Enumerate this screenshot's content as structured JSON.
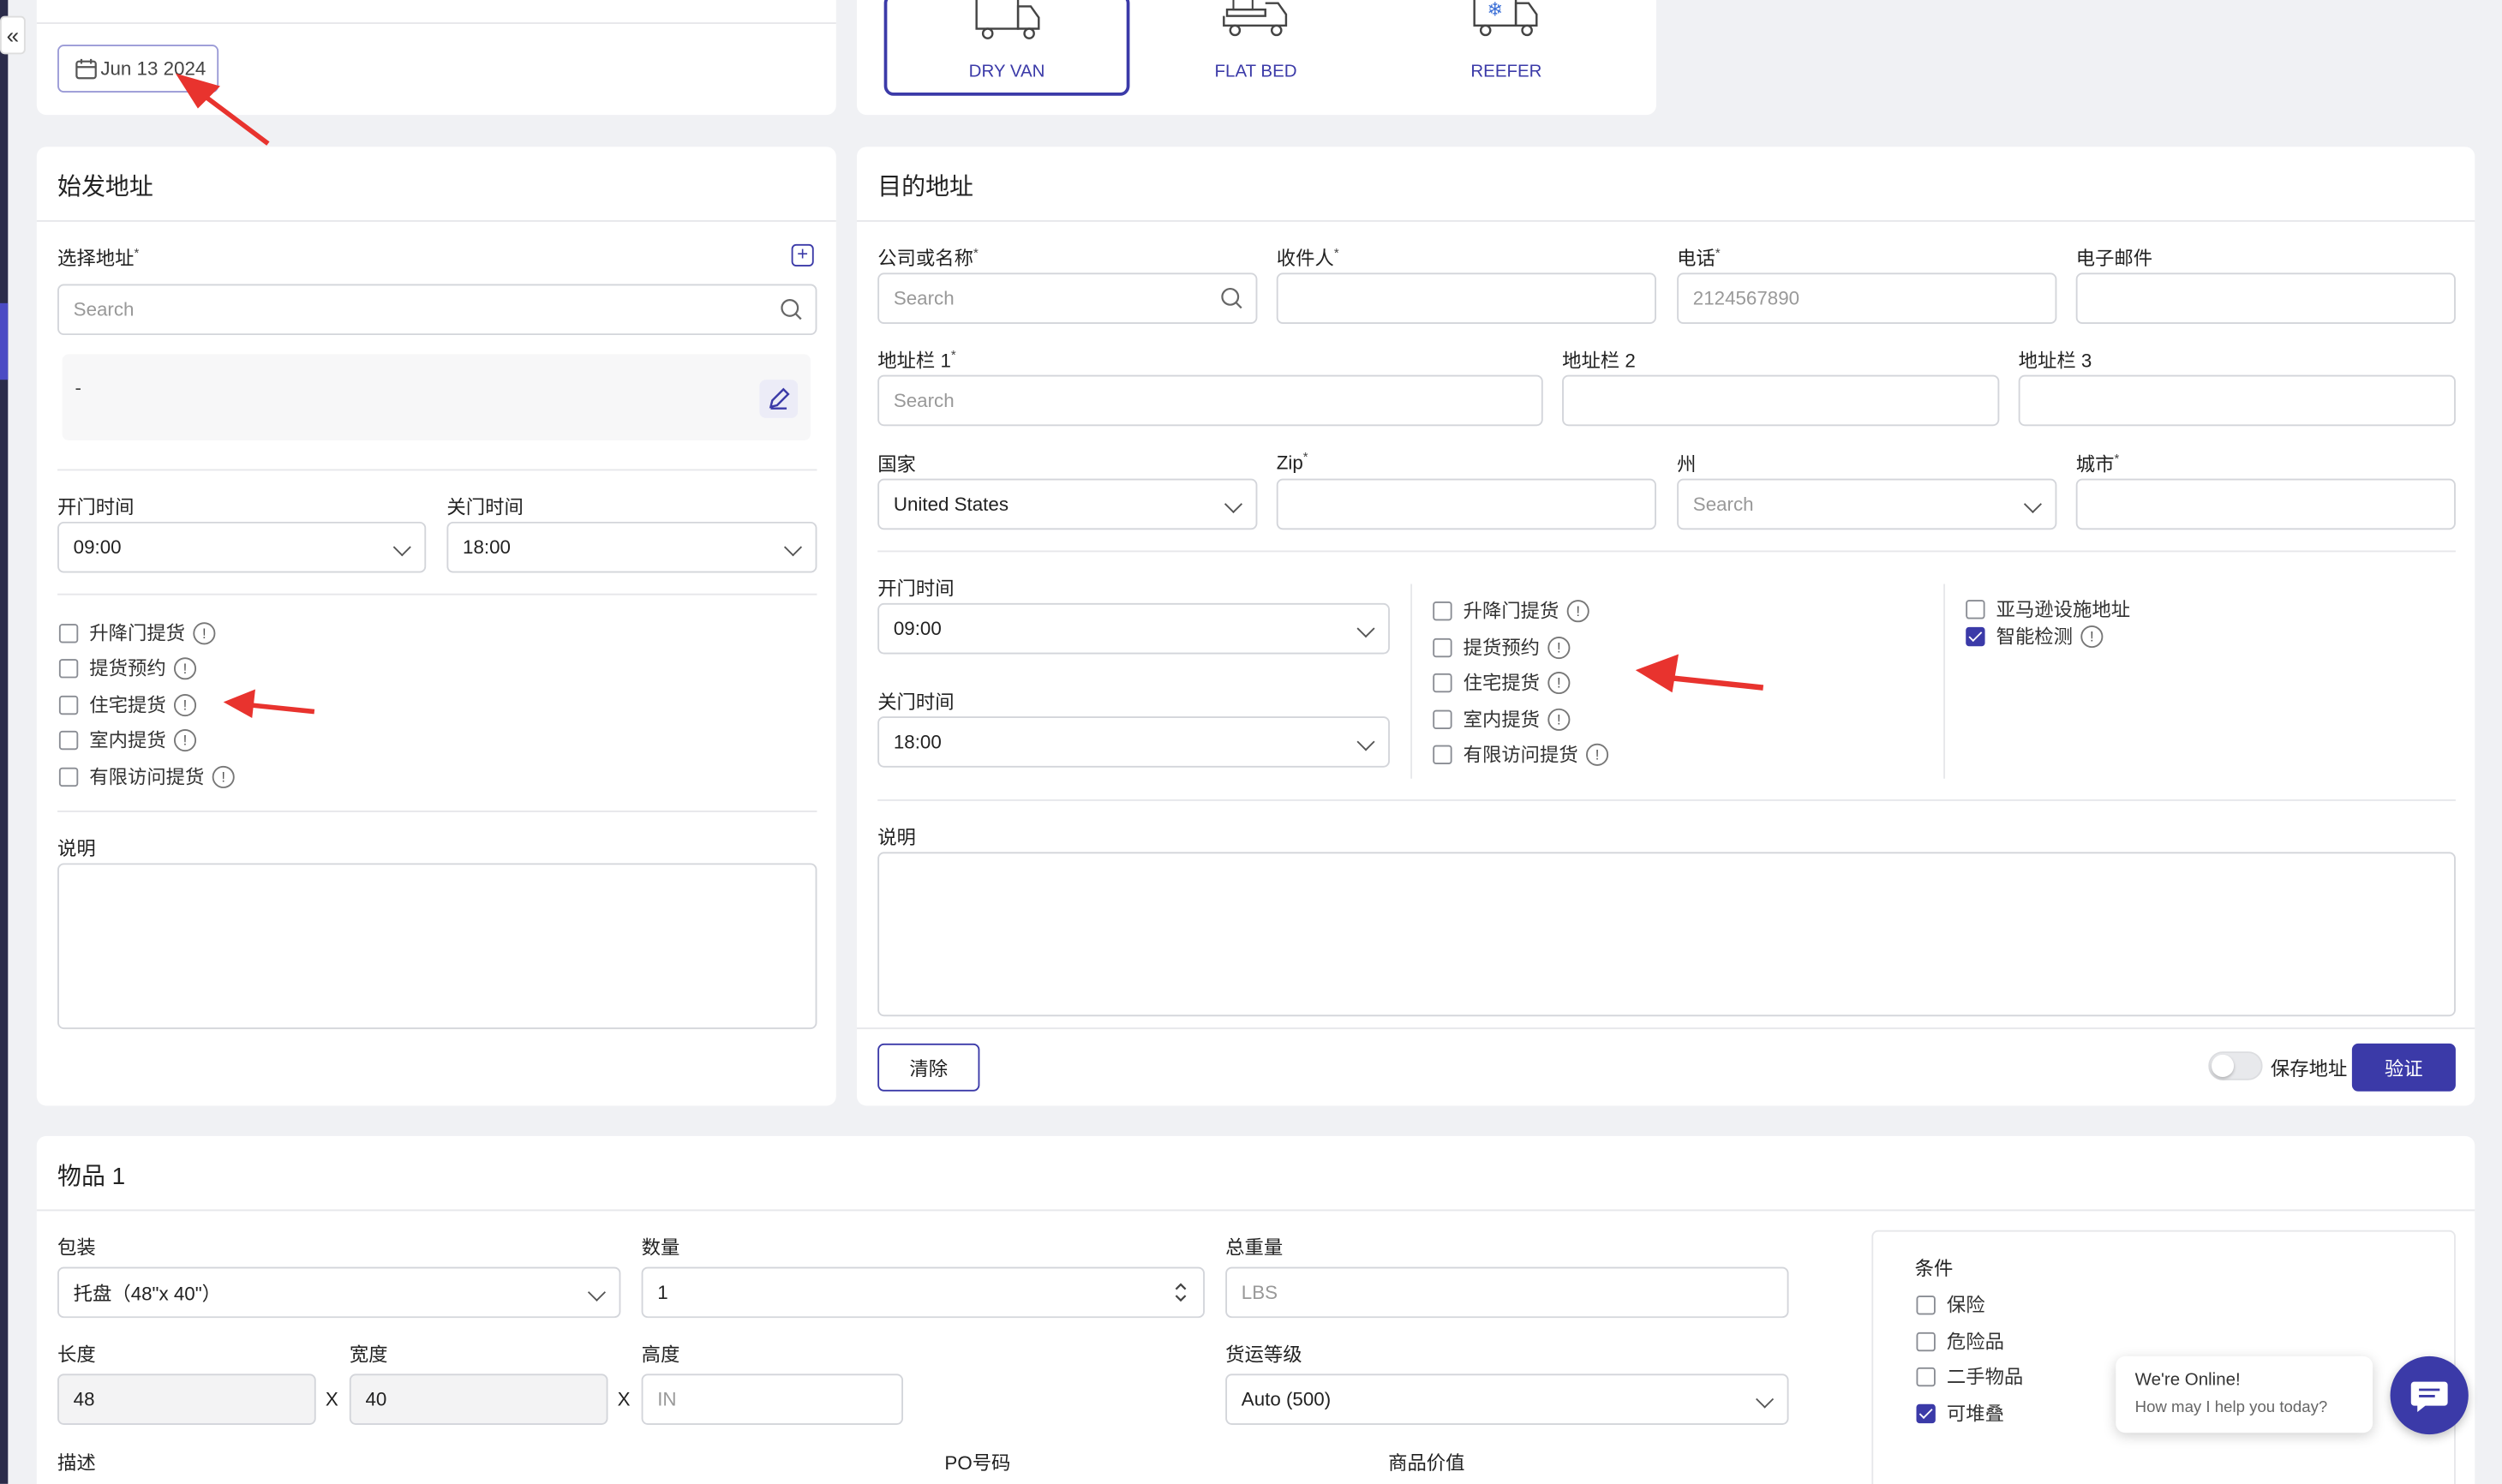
{
  "sidebar": {
    "collapse_glyph": "«"
  },
  "date": {
    "value": "Jun 13 2024"
  },
  "equipment": {
    "items": [
      {
        "label": "DRY VAN"
      },
      {
        "label": "FLAT BED"
      },
      {
        "label": "REEFER"
      }
    ]
  },
  "origin": {
    "title": "始发地址",
    "select_label": "选择地址",
    "search_placeholder": "Search",
    "address_value": "-",
    "open_label": "开门时间",
    "open_value": "09:00",
    "close_label": "关门时间",
    "close_value": "18:00",
    "options": [
      "升降门提货",
      "提货预约",
      "住宅提货",
      "室内提货",
      "有限访问提货"
    ],
    "note_label": "说明"
  },
  "dest": {
    "title": "目的地址",
    "company_label": "公司或名称",
    "company_placeholder": "Search",
    "recipient_label": "收件人",
    "phone_label": "电话",
    "phone_placeholder": "2124567890",
    "email_label": "电子邮件",
    "addr1_label": "地址栏 1",
    "addr1_placeholder": "Search",
    "addr2_label": "地址栏 2",
    "addr3_label": "地址栏 3",
    "country_label": "国家",
    "country_value": "United States",
    "zip_label": "Zip",
    "state_label": "州",
    "state_placeholder": "Search",
    "city_label": "城市",
    "open_label": "开门时间",
    "open_value": "09:00",
    "close_label": "关门时间",
    "close_value": "18:00",
    "options": [
      "升降门提货",
      "提货预约",
      "住宅提货",
      "室内提货",
      "有限访问提货"
    ],
    "extra_options": [
      {
        "label": "亚马逊设施地址",
        "checked": false
      },
      {
        "label": "智能检测",
        "checked": true
      }
    ],
    "note_label": "说明",
    "clear_label": "清除",
    "save_label": "保存地址",
    "verify_label": "验证"
  },
  "item": {
    "title": "物品 1",
    "pack_label": "包装",
    "pack_value": "托盘（48\"x 40\"）",
    "qty_label": "数量",
    "qty_value": "1",
    "weight_label": "总重量",
    "weight_placeholder": "LBS",
    "length_label": "长度",
    "length_value": "48",
    "width_label": "宽度",
    "width_value": "40",
    "height_label": "高度",
    "height_placeholder": "IN",
    "times_glyph": "X",
    "class_label": "货运等级",
    "class_value": "Auto (500)",
    "desc_label": "描述",
    "po_label": "PO号码",
    "value_label": "商品价值",
    "cond_label": "条件",
    "conditions": [
      {
        "label": "保险",
        "checked": false
      },
      {
        "label": "危险品",
        "checked": false
      },
      {
        "label": "二手物品",
        "checked": false
      },
      {
        "label": "可堆叠",
        "checked": true
      }
    ]
  },
  "chat": {
    "title": "We're Online!",
    "subtitle": "How may I help you today?"
  },
  "colors": {
    "accent": "#3b3aa8",
    "annotation": "#e8332e"
  }
}
